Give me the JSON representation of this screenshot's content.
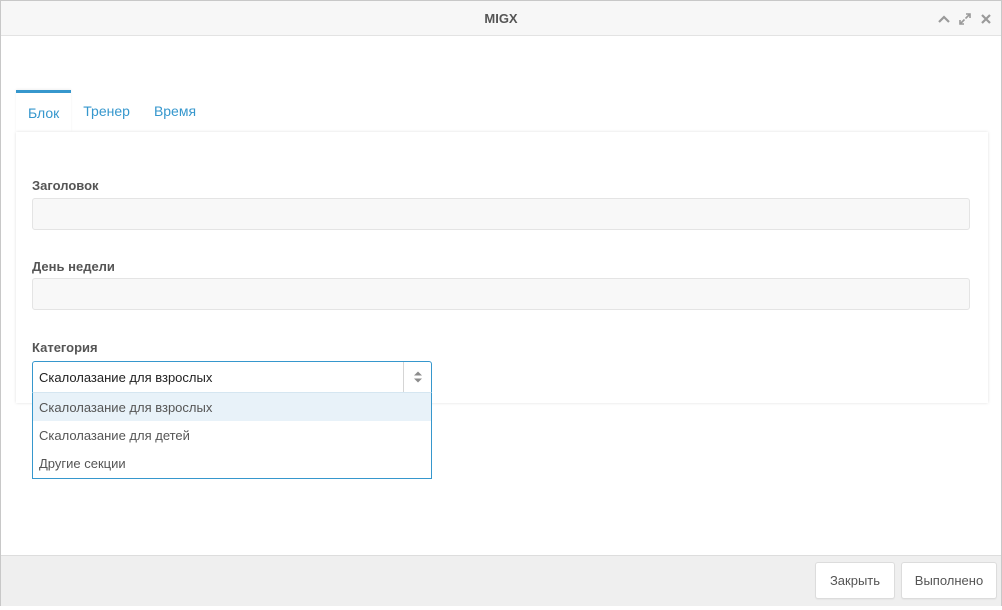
{
  "window": {
    "title": "MIGX",
    "tools": [
      "collapse-icon",
      "expand-icon",
      "close-icon"
    ]
  },
  "tabs": [
    {
      "label": "Блок",
      "active": true
    },
    {
      "label": "Тренер",
      "active": false
    },
    {
      "label": "Время",
      "active": false
    }
  ],
  "form": {
    "title_label": "Заголовок",
    "title_value": "",
    "weekday_label": "День недели",
    "weekday_value": "",
    "category_label": "Категория",
    "category_value": "Скалолазание для взрослых",
    "category_options": [
      "Скалолазание для взрослых",
      "Скалолазание для детей",
      "Другие секции"
    ]
  },
  "footer": {
    "close_label": "Закрыть",
    "done_label": "Выполнено"
  },
  "colors": {
    "accent": "#3697cd",
    "text": "#555555",
    "selected_option": "#e8f2f9"
  }
}
